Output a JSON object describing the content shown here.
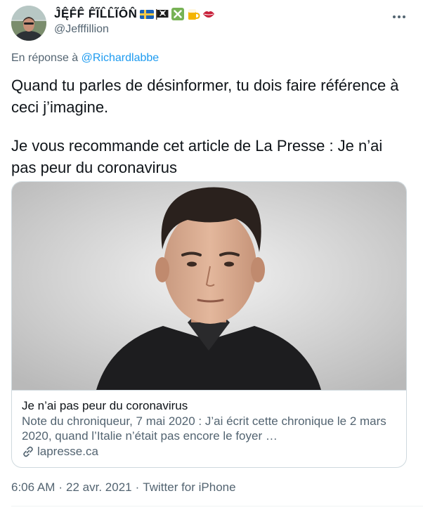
{
  "author": {
    "display_name": "ĴĘ̂F̂F̂ F̂ĨL̂L̂ĨÔN̂",
    "handle": "@Jefffillion",
    "emoji_icons": [
      "sweden-flag-icon",
      "pirate-flag-icon",
      "cross-mark-icon",
      "beer-mug-icon",
      "lips-icon"
    ]
  },
  "reply_context": {
    "prefix": "En réponse à",
    "mention": "@Richardlabbe"
  },
  "tweet": {
    "paragraph_1": "Quand tu parles de désinformer, tu dois faire référence à ceci j’imagine.",
    "paragraph_2": "Je vous recommande cet article de La Presse : Je n’ai pas peur du coronavirus"
  },
  "link_card": {
    "title": "Je n’ai pas peur du coronavirus",
    "description": "Note du chroniqueur, 7 mai 2020 : J’ai écrit cette chronique le 2 mars 2020, quand l’Italie n’était pas encore le foyer …",
    "domain": "lapresse.ca",
    "domain_icon": "link-icon"
  },
  "meta": {
    "time": "6:06 AM",
    "separator": "·",
    "date": "22 avr. 2021",
    "separator_2": "·",
    "source": "Twitter for iPhone"
  },
  "colors": {
    "text_primary": "#0f1419",
    "text_secondary": "#536471",
    "accent": "#1d9bf0",
    "border": "#cfd9de"
  }
}
